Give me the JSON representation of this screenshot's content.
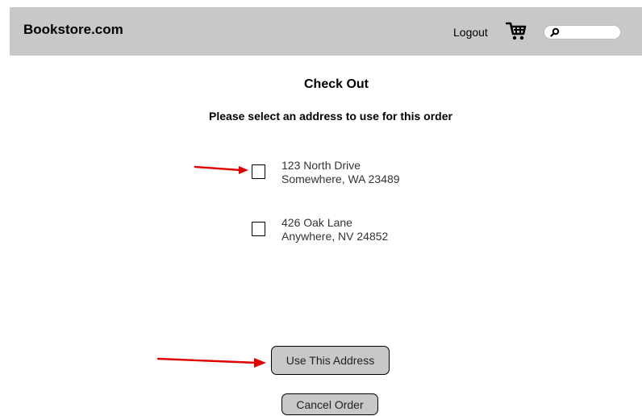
{
  "header": {
    "brand": "Bookstore.com",
    "logout_label": "Logout",
    "cart_icon": "shopping-cart-icon",
    "search": {
      "value": "",
      "placeholder": "",
      "icon": "search-icon"
    },
    "background_color": "#c8c8c8"
  },
  "main": {
    "title": "Check Out",
    "subtitle": "Please select an address to use for this order",
    "addresses": [
      {
        "line1": "123 North Drive",
        "line2": "Somewhere, WA 23489",
        "checked": false
      },
      {
        "line1": "426 Oak Lane",
        "line2": "Anywhere, NV 24852",
        "checked": false
      }
    ],
    "use_address_label": "Use This Address",
    "cancel_label": "Cancel Order"
  },
  "annotations": {
    "arrow_color": "#e00000"
  }
}
